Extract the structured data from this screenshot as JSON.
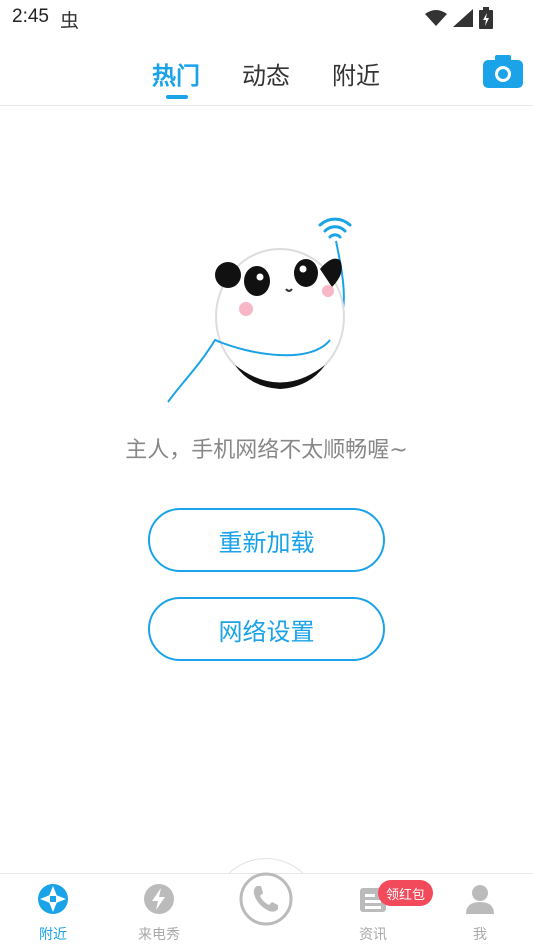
{
  "status_bar": {
    "time": "2:45",
    "bug_glyph": "虫"
  },
  "top_nav": {
    "tabs": [
      {
        "label": "热门",
        "active": true
      },
      {
        "label": "动态",
        "active": false
      },
      {
        "label": "附近",
        "active": false
      }
    ],
    "camera_icon": "camera-icon"
  },
  "main": {
    "message": "主人，手机网络不太顺畅喔~",
    "reload_label": "重新加载",
    "network_settings_label": "网络设置"
  },
  "bottom_nav": {
    "items": [
      {
        "label": "附近",
        "icon": "aperture-icon",
        "active": true
      },
      {
        "label": "来电秀",
        "icon": "lightning-icon",
        "active": false
      },
      {
        "label": "",
        "icon": "phone-icon",
        "active": false
      },
      {
        "label": "资讯",
        "icon": "news-icon",
        "active": false
      },
      {
        "label": "我",
        "icon": "person-icon",
        "active": false
      }
    ],
    "badge": "领红包"
  },
  "colors": {
    "accent": "#1aa3e8",
    "badge": "#f24a5b",
    "muted": "#aaaaaa"
  }
}
